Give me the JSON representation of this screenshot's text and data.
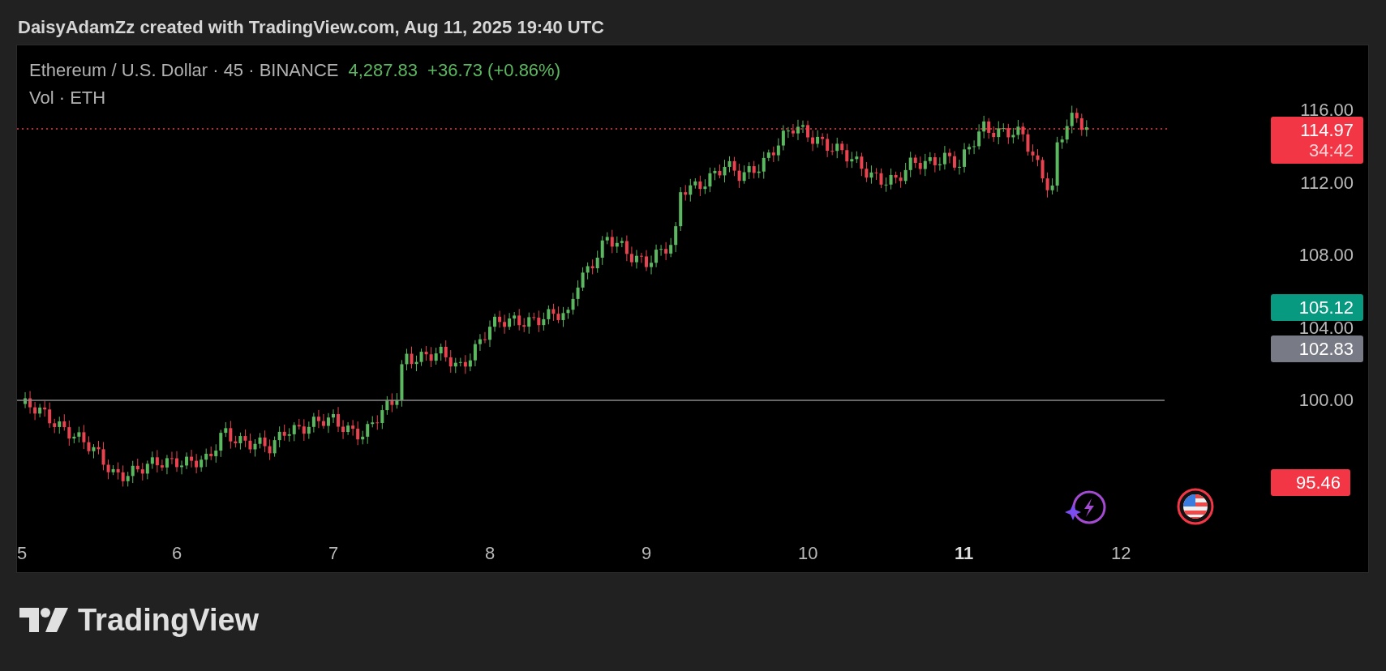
{
  "attribution": "DaisyAdamZz created with TradingView.com, Aug 11, 2025 19:40 UTC",
  "legend": {
    "symbol": "Ethereum / U.S. Dollar · 45 · BINANCE",
    "price": "4,287.83",
    "change": "+36.73 (+0.86%)",
    "volume": "Vol · ETH"
  },
  "price_axis": [
    "116.00",
    "112.00",
    "108.00",
    "104.00",
    "100.00"
  ],
  "price_labels": [
    {
      "text": "114.97",
      "countdown": "34:42",
      "color": "#f23645"
    },
    {
      "text": "105.12",
      "color": "#089981"
    },
    {
      "text": "102.83",
      "color": "#787b86"
    },
    {
      "text": "95.46",
      "color": "#f23645"
    }
  ],
  "time_axis": [
    {
      "label": "5",
      "bold": false
    },
    {
      "label": "6",
      "bold": false
    },
    {
      "label": "7",
      "bold": false
    },
    {
      "label": "8",
      "bold": false
    },
    {
      "label": "9",
      "bold": false
    },
    {
      "label": "10",
      "bold": false
    },
    {
      "label": "11",
      "bold": true
    },
    {
      "label": "12",
      "bold": false
    }
  ],
  "brand": "TradingView"
}
